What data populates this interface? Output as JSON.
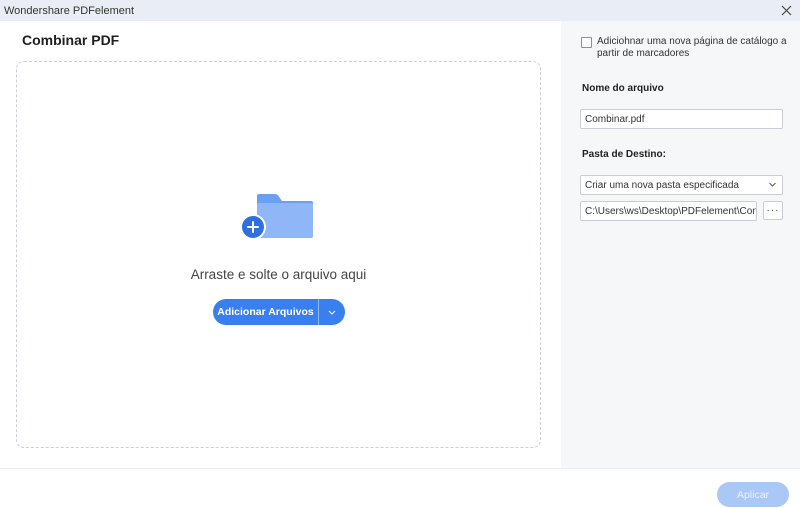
{
  "window": {
    "title": "Wondershare PDFelement"
  },
  "left": {
    "heading": "Combinar PDF",
    "dropzone": {
      "text": "Arraste e solte o arquivo aqui",
      "add_button_label": "Adicionar Arquivos"
    }
  },
  "right": {
    "checkbox_label": "Adiciohnar uma nova página de catálogo a partir de marcadores",
    "checkbox_checked": false,
    "filename_label": "Nome do arquivo",
    "filename_value": "Combinar.pdf",
    "destination_label": "Pasta de Destino:",
    "destination_select": "Criar uma nova pasta especificada",
    "destination_path": "C:\\Users\\ws\\Desktop\\PDFelement\\Con",
    "browse_label": "···"
  },
  "footer": {
    "apply_label": "Aplicar"
  },
  "colors": {
    "accent": "#3a7ff0",
    "apply_disabled": "#a9c8f5",
    "titlebar": "#e9eef6",
    "sidebar": "#f6f7f9"
  }
}
